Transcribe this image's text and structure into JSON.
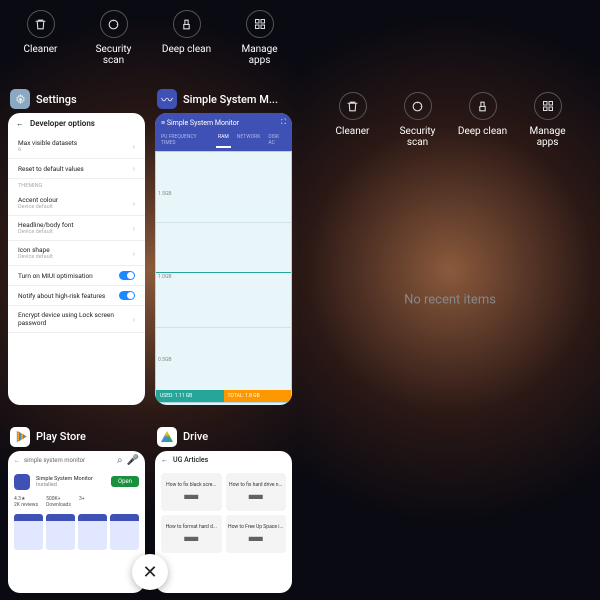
{
  "toolbar": {
    "items": [
      {
        "label": "Cleaner",
        "icon": "trash"
      },
      {
        "label": "Security scan",
        "icon": "scan"
      },
      {
        "label": "Deep clean",
        "icon": "broom"
      },
      {
        "label": "Manage apps",
        "icon": "grid"
      }
    ]
  },
  "left_pane": {
    "apps": {
      "settings": {
        "name": "Settings",
        "screen_title": "Developer options",
        "rows": [
          {
            "title": "Max visible datasets",
            "sub": "6"
          },
          {
            "title": "Reset to default values"
          }
        ],
        "section": "THEMING",
        "rows2": [
          {
            "title": "Accent colour",
            "sub": "Device default"
          },
          {
            "title": "Headline/body font",
            "sub": "Device default"
          },
          {
            "title": "Icon shape",
            "sub": "Device default"
          }
        ],
        "rows3": [
          {
            "title": "Turn on MIUI optimisation",
            "toggle": true
          },
          {
            "title": "Notify about high-risk features",
            "toggle": true
          },
          {
            "title": "Encrypt device using Lock screen password"
          }
        ]
      },
      "monitor": {
        "name": "Simple System M...",
        "bar_title": "Simple System Monitor",
        "tabs": [
          "PU FREQUENCY TIMES",
          "RAM",
          "NETWORK",
          "DISK AC"
        ],
        "active_tab": "RAM",
        "y_labels": [
          "1.5GB",
          "1.0GB",
          "0.5GB"
        ],
        "footer": {
          "used": "USED: 1.11 GB",
          "total": "TOTAL: 1.8 GB"
        }
      },
      "play": {
        "name": "Play Store",
        "query": "simple system monitor",
        "result_title": "Simple System Monitor",
        "result_sub": "Installed",
        "open_label": "Open",
        "stats": {
          "rating": "4.3★",
          "reviews": "2K reviews",
          "downloads": "500K+",
          "downloads_sub": "Downloads",
          "rated": "3+"
        }
      },
      "drive": {
        "name": "Drive",
        "bar_title": "UG Articles",
        "items": [
          "How to fix black scre...",
          "How to fix hard drive n...",
          "How to format hard d...",
          "How to Free Up Space i..."
        ]
      }
    },
    "close_label": "✕"
  },
  "right_pane": {
    "empty_message": "No recent items"
  }
}
